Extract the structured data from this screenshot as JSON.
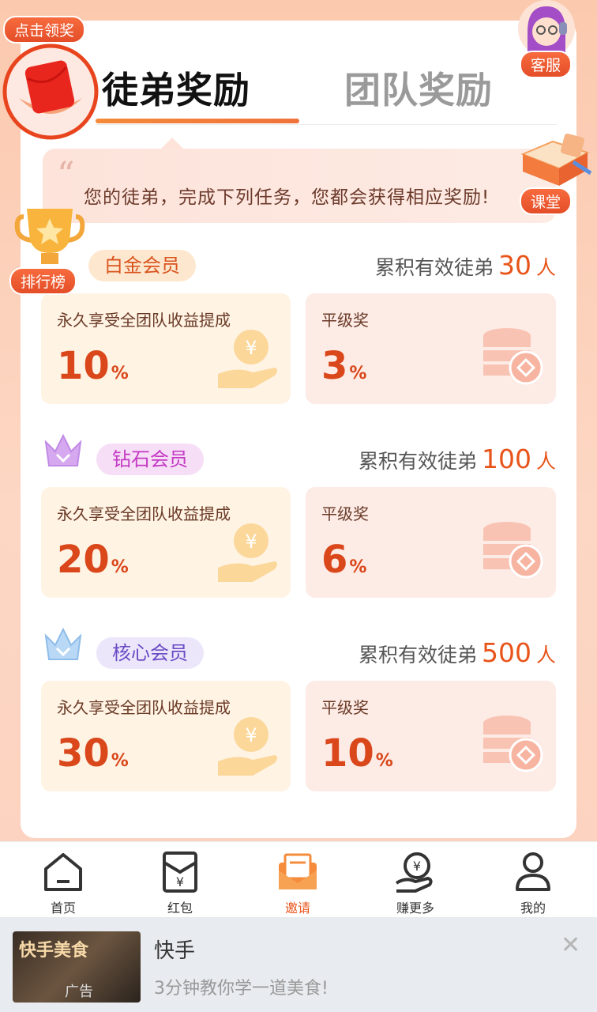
{
  "tabs": {
    "active": "徒弟奖励",
    "inactive": "团队奖励"
  },
  "floating": {
    "claim_label": "点击领奖",
    "service_label": "客服",
    "class_label": "课堂",
    "ranking_label": "排行榜"
  },
  "notice": {
    "quote": "“",
    "text": "您的徒弟，完成下列任务，您都会获得相应奖励!"
  },
  "tiers": [
    {
      "name": "白金会员",
      "count_prefix": "累积有效徒弟",
      "count": "30",
      "count_unit": "人",
      "left_label": "永久享受全团队收益提成",
      "left_value": "10",
      "left_unit": "%",
      "right_label": "平级奖",
      "right_value": "3",
      "right_unit": "%",
      "badge_bg": "#fde8cf",
      "badge_color": "#d9531e"
    },
    {
      "name": "钻石会员",
      "count_prefix": "累积有效徒弟",
      "count": "100",
      "count_unit": "人",
      "left_label": "永久享受全团队收益提成",
      "left_value": "20",
      "left_unit": "%",
      "right_label": "平级奖",
      "right_value": "6",
      "right_unit": "%",
      "badge_bg": "#f6def6",
      "badge_color": "#c43ac4"
    },
    {
      "name": "核心会员",
      "count_prefix": "累积有效徒弟",
      "count": "500",
      "count_unit": "人",
      "left_label": "永久享受全团队收益提成",
      "left_value": "30",
      "left_unit": "%",
      "right_label": "平级奖",
      "right_value": "10",
      "right_unit": "%",
      "badge_bg": "#ece6fb",
      "badge_color": "#6a4bc4"
    }
  ],
  "nav": {
    "items": [
      {
        "label": "首页",
        "icon": "home-icon"
      },
      {
        "label": "红包",
        "icon": "red-envelope-icon"
      },
      {
        "label": "邀请",
        "icon": "invite-icon",
        "active": true
      },
      {
        "label": "赚更多",
        "icon": "earn-more-icon"
      },
      {
        "label": "我的",
        "icon": "profile-icon"
      }
    ]
  },
  "ad": {
    "thumb_text": "快手美食",
    "tag": "广告",
    "title": "快手",
    "desc": "3分钟教你学一道美食!",
    "close": "✕"
  },
  "colors": {
    "accent": "#e8541a",
    "background": "#fbc9ae"
  }
}
